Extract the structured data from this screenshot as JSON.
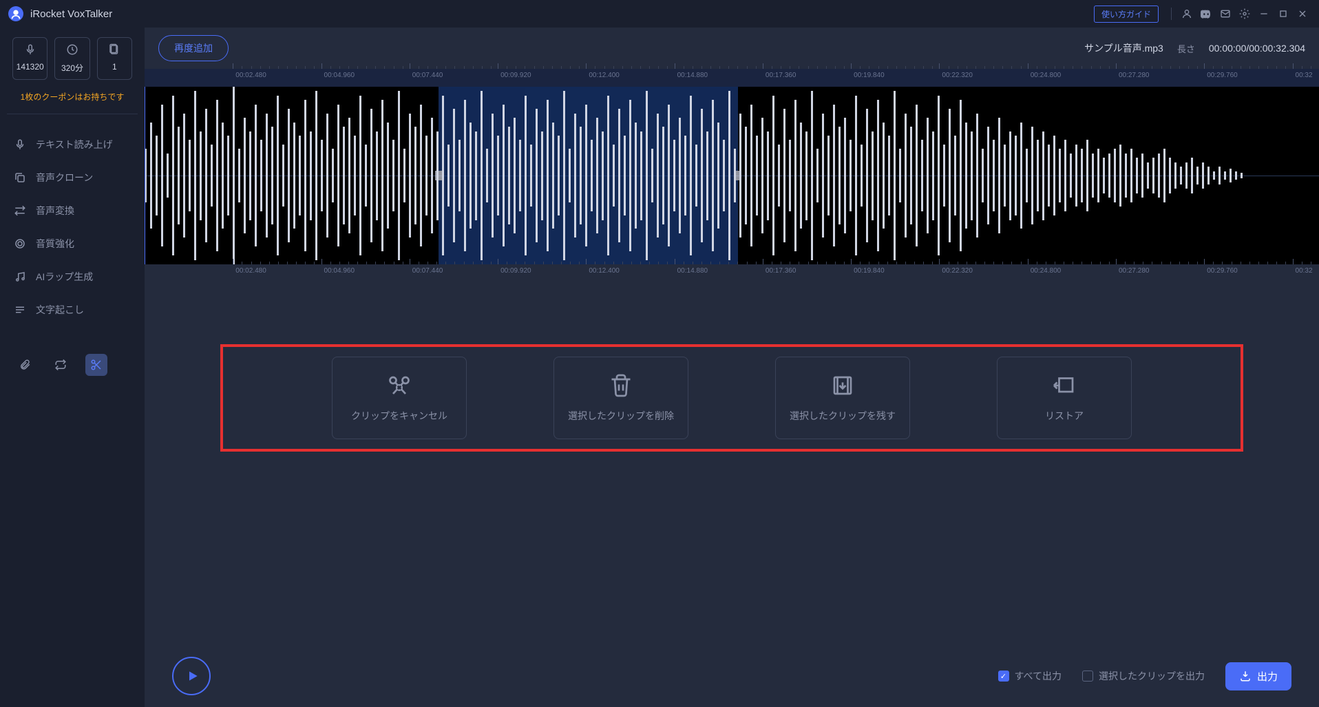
{
  "app": {
    "title": "iRocket VoxTalker",
    "guide": "使い方ガイド"
  },
  "credits": {
    "items": [
      {
        "icon": "mic",
        "value": "141320"
      },
      {
        "icon": "time",
        "value": "320分"
      },
      {
        "icon": "doc",
        "value": "1"
      }
    ],
    "coupon": "1枚のクーポンはお持ちです"
  },
  "nav": [
    {
      "icon": "tts",
      "label": "テキスト読み上げ"
    },
    {
      "icon": "clone",
      "label": "音声クローン"
    },
    {
      "icon": "convert",
      "label": "音声変換"
    },
    {
      "icon": "enhance",
      "label": "音質強化"
    },
    {
      "icon": "rap",
      "label": "AIラップ生成"
    },
    {
      "icon": "transcribe",
      "label": "文字起こし"
    }
  ],
  "topbar": {
    "add_again": "再度追加",
    "filename": "サンプル音声.mp3",
    "length_label": "長さ",
    "time": "00:00:00/00:00:32.304"
  },
  "timeline": {
    "ticks": [
      "00:02.480",
      "00:04.960",
      "00:07.440",
      "00:09.920",
      "00:12.400",
      "00:14.880",
      "00:17.360",
      "00:19.840",
      "00:22.320",
      "00:24.800",
      "00:27.280",
      "00:29.760",
      "00:32"
    ],
    "selection_start_pct": 25.0,
    "selection_end_pct": 50.5,
    "playhead_pct": 0
  },
  "actions": {
    "cancel": "クリップをキャンセル",
    "delete": "選択したクリップを削除",
    "keep": "選択したクリップを残す",
    "restore": "リストア"
  },
  "footer": {
    "export_all": "すべて出力",
    "export_selected": "選択したクリップを出力",
    "export": "出力"
  }
}
